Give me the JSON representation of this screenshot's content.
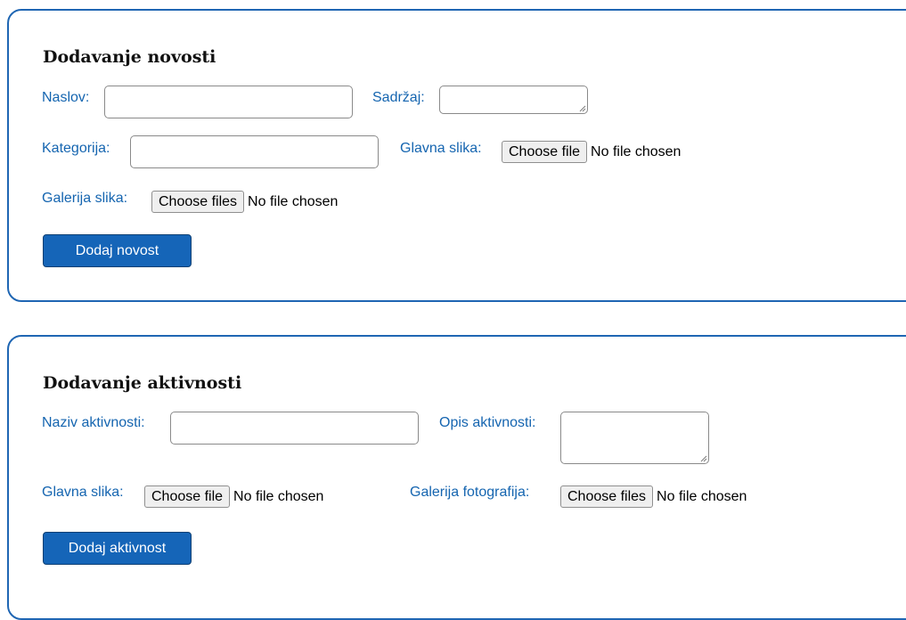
{
  "news_form": {
    "title": "Dodavanje novosti",
    "naslov_label": "Naslov:",
    "naslov_value": "",
    "sadrzaj_label": "Sadržaj:",
    "sadrzaj_value": "",
    "kategorija_label": "Kategorija:",
    "kategorija_value": "",
    "glavna_slika_label": "Glavna slika:",
    "glavna_slika_button": "Choose file",
    "glavna_slika_status": "No file chosen",
    "galerija_label": "Galerija slika:",
    "galerija_button": "Choose files",
    "galerija_status": "No file chosen",
    "submit_label": "Dodaj novost"
  },
  "activity_form": {
    "title": "Dodavanje aktivnosti",
    "naziv_label": "Naziv aktivnosti:",
    "naziv_value": "",
    "opis_label": "Opis aktivnosti:",
    "opis_value": "",
    "glavna_slika_label": "Glavna slika:",
    "glavna_slika_button": "Choose file",
    "glavna_slika_status": "No file chosen",
    "galerija_label": "Galerija fotografija:",
    "galerija_button": "Choose files",
    "galerija_status": "No file chosen",
    "submit_label": "Dodaj aktivnost"
  },
  "colors": {
    "accent": "#1565b8",
    "label": "#1565b0",
    "card_border": "#1f66b3"
  },
  "icons": {
    "textarea_grip": "resize-grip-icon"
  }
}
